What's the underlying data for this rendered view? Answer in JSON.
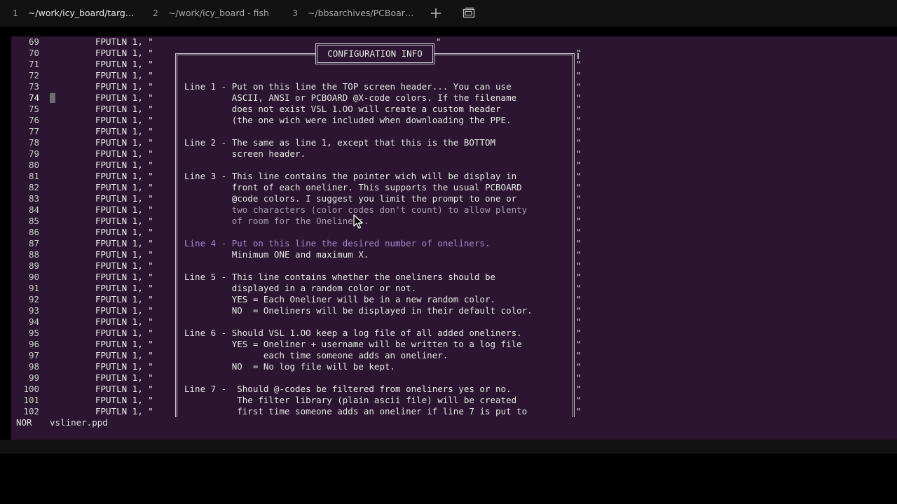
{
  "tabs": [
    {
      "num": "1",
      "title": "~/work/icy_board/targ…",
      "active": true
    },
    {
      "num": "2",
      "title": "~/work/icy_board - fish",
      "active": false
    },
    {
      "num": "3",
      "title": "~/bbsarchives/PCBoar…",
      "active": false
    }
  ],
  "tab_actions": {
    "new_tab_icon": "plus-icon",
    "windows_icon": "windows-icon"
  },
  "editor": {
    "statement": "FPUTLN 1, \"",
    "right_quote": "\"",
    "line_numbers": [
      "69",
      "70",
      "71",
      "72",
      "73",
      "74",
      "75",
      "76",
      "77",
      "78",
      "79",
      "80",
      "81",
      "82",
      "83",
      "84",
      "85",
      "86",
      "87",
      "88",
      "89",
      "90",
      "91",
      "92",
      "93",
      "94",
      "95",
      "96",
      "97",
      "98",
      "99",
      "100",
      "101",
      "102"
    ],
    "current_line": "74"
  },
  "dialog": {
    "title": "CONFIGURATION INFO",
    "lines": [
      "Line 1 - Put on this line the TOP screen header... You can use",
      "         ASCII, ANSI or PCBOARD @X-code colors. If the filename",
      "         does not exist VSL 1.OO will create a custom header",
      "         (the one wich were included when downloading the PPE.",
      "",
      "Line 2 - The same as line 1, except that this is the BOTTOM",
      "         screen header.",
      "",
      "Line 3 - This line contains the pointer wich will be display in",
      "         front of each oneliner. This supports the usual PCBOARD",
      "         @code colors. I suggest you limit the prompt to one or",
      "         two characters (color codes don't count) to allow plenty",
      "         of room for the Oneliners.",
      "",
      "Line 4 - Put on this line the desired number of oneliners.",
      "         Minimum ONE and maximum X.",
      "",
      "Line 5 - This line contains whether the oneliners should be",
      "         displayed in a random color or not.",
      "         YES = Each Oneliner will be in a new random color.",
      "         NO  = Oneliners will be displayed in their default color.",
      "",
      "Line 6 - Should VSL 1.OO keep a log file of all added oneliners.",
      "         YES = Oneliner + username will be written to a log file",
      "               each time someone adds an oneliner.",
      "         NO  = No log file will be kept.",
      "",
      "Line 7 -  Should @-codes be filtered from oneliners yes or no.",
      "          The filter library (plain ascii file) will be created",
      "          first time someone adds an oneliner if line 7 is put to"
    ]
  },
  "statusbar": {
    "mode": "NOR",
    "file": "vsliner.ppd"
  },
  "colors": {
    "background": "#2b1530",
    "tabbar": "#121212",
    "text": "#e4e4e4",
    "highlight": "#a58ad0"
  }
}
